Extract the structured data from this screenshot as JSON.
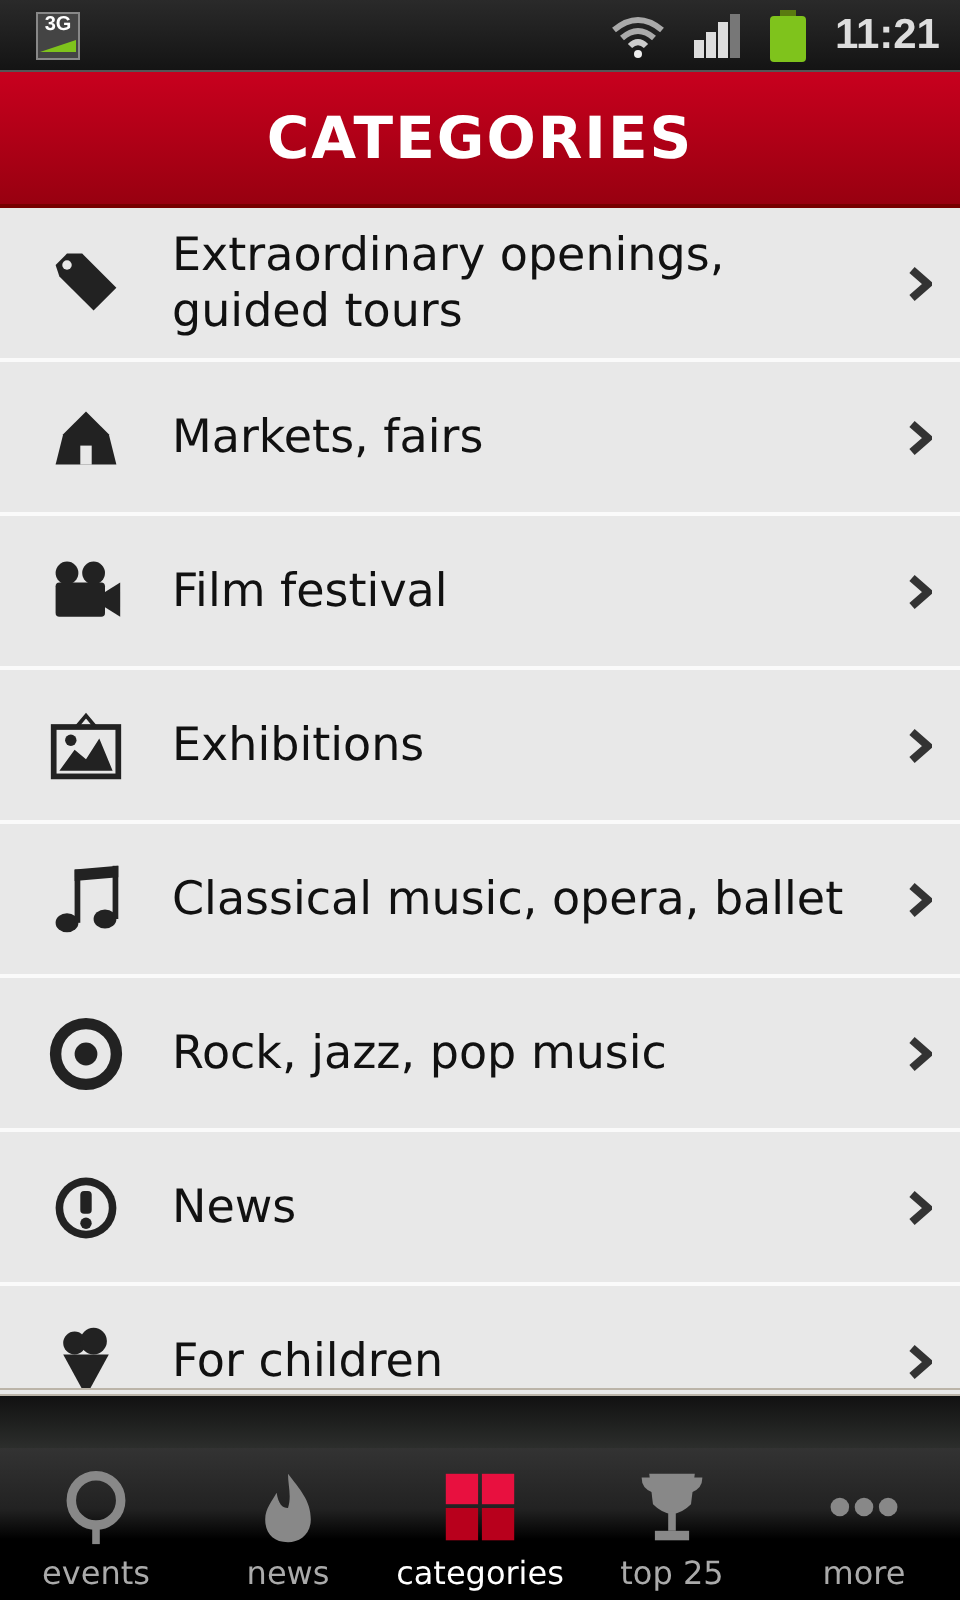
{
  "status_bar": {
    "network": "3G",
    "time": "11:21"
  },
  "header": {
    "title": "CATEGORIES"
  },
  "categories": [
    {
      "label": "Extraordinary openings, guided tours"
    },
    {
      "label": "Markets, fairs"
    },
    {
      "label": "Film festival"
    },
    {
      "label": "Exhibitions"
    },
    {
      "label": "Classical music, opera, ballet"
    },
    {
      "label": "Rock, jazz, pop music"
    },
    {
      "label": "News"
    },
    {
      "label": "For children"
    }
  ],
  "tabs": [
    {
      "label": "events",
      "selected": false
    },
    {
      "label": "news",
      "selected": false
    },
    {
      "label": "categories",
      "selected": true
    },
    {
      "label": "top 25",
      "selected": false
    },
    {
      "label": "more",
      "selected": false
    }
  ]
}
